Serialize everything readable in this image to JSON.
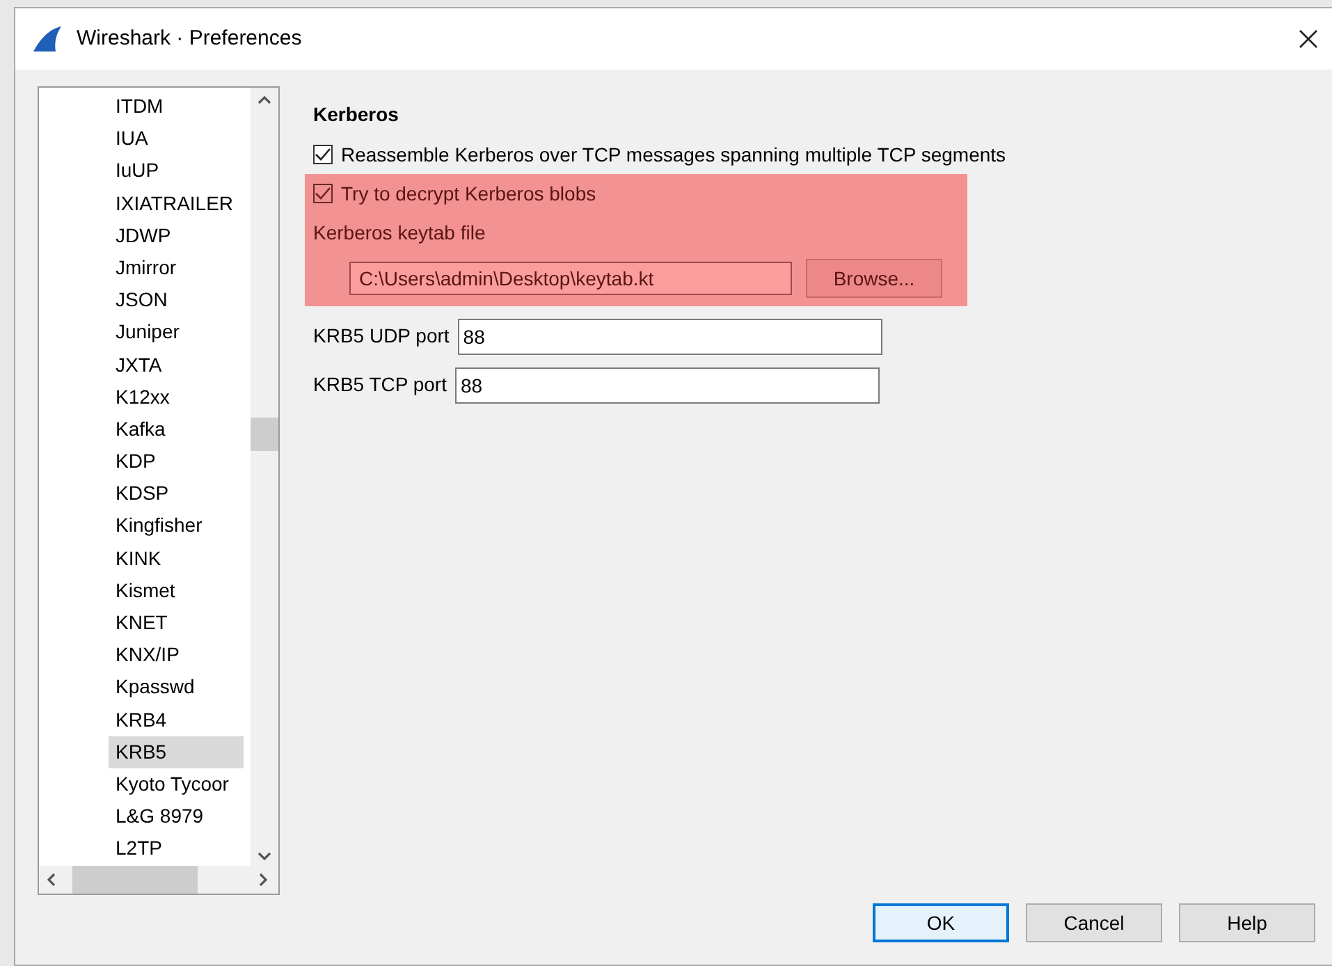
{
  "window": {
    "title": "Wireshark · Preferences"
  },
  "protocol_list": {
    "items": [
      {
        "label": "ITDM",
        "selected": false
      },
      {
        "label": "IUA",
        "selected": false
      },
      {
        "label": "IuUP",
        "selected": false
      },
      {
        "label": "IXIATRAILER",
        "selected": false
      },
      {
        "label": "JDWP",
        "selected": false
      },
      {
        "label": "Jmirror",
        "selected": false
      },
      {
        "label": "JSON",
        "selected": false
      },
      {
        "label": "Juniper",
        "selected": false
      },
      {
        "label": "JXTA",
        "selected": false
      },
      {
        "label": "K12xx",
        "selected": false
      },
      {
        "label": "Kafka",
        "selected": false
      },
      {
        "label": "KDP",
        "selected": false
      },
      {
        "label": "KDSP",
        "selected": false
      },
      {
        "label": "Kingfisher",
        "selected": false
      },
      {
        "label": "KINK",
        "selected": false
      },
      {
        "label": "Kismet",
        "selected": false
      },
      {
        "label": "KNET",
        "selected": false
      },
      {
        "label": "KNX/IP",
        "selected": false
      },
      {
        "label": "Kpasswd",
        "selected": false
      },
      {
        "label": "KRB4",
        "selected": false
      },
      {
        "label": "KRB5",
        "selected": true
      },
      {
        "label": "Kyoto Tycoor",
        "selected": false
      },
      {
        "label": "L&G 8979",
        "selected": false
      },
      {
        "label": "L2TP",
        "selected": false
      }
    ]
  },
  "panel": {
    "title": "Kerberos",
    "options": [
      {
        "kind": "checkbox",
        "label": "Reassemble Kerberos over TCP messages spanning multiple TCP segments",
        "checked": true,
        "highlighted": false
      },
      {
        "kind": "checkbox",
        "label": "Try to decrypt Kerberos blobs",
        "checked": true,
        "highlighted": true
      },
      {
        "kind": "file",
        "label": "Kerberos keytab file",
        "value": "C:\\Users\\admin\\Desktop\\keytab.kt",
        "button": "Browse...",
        "highlighted": true
      },
      {
        "kind": "text",
        "label": "KRB5 UDP port",
        "value": "88",
        "highlighted": false
      },
      {
        "kind": "text",
        "label": "KRB5 TCP port",
        "value": "88",
        "highlighted": false
      }
    ]
  },
  "buttons": [
    {
      "label": "OK",
      "default": true
    },
    {
      "label": "Cancel",
      "default": false
    },
    {
      "label": "Help",
      "default": false
    }
  ]
}
